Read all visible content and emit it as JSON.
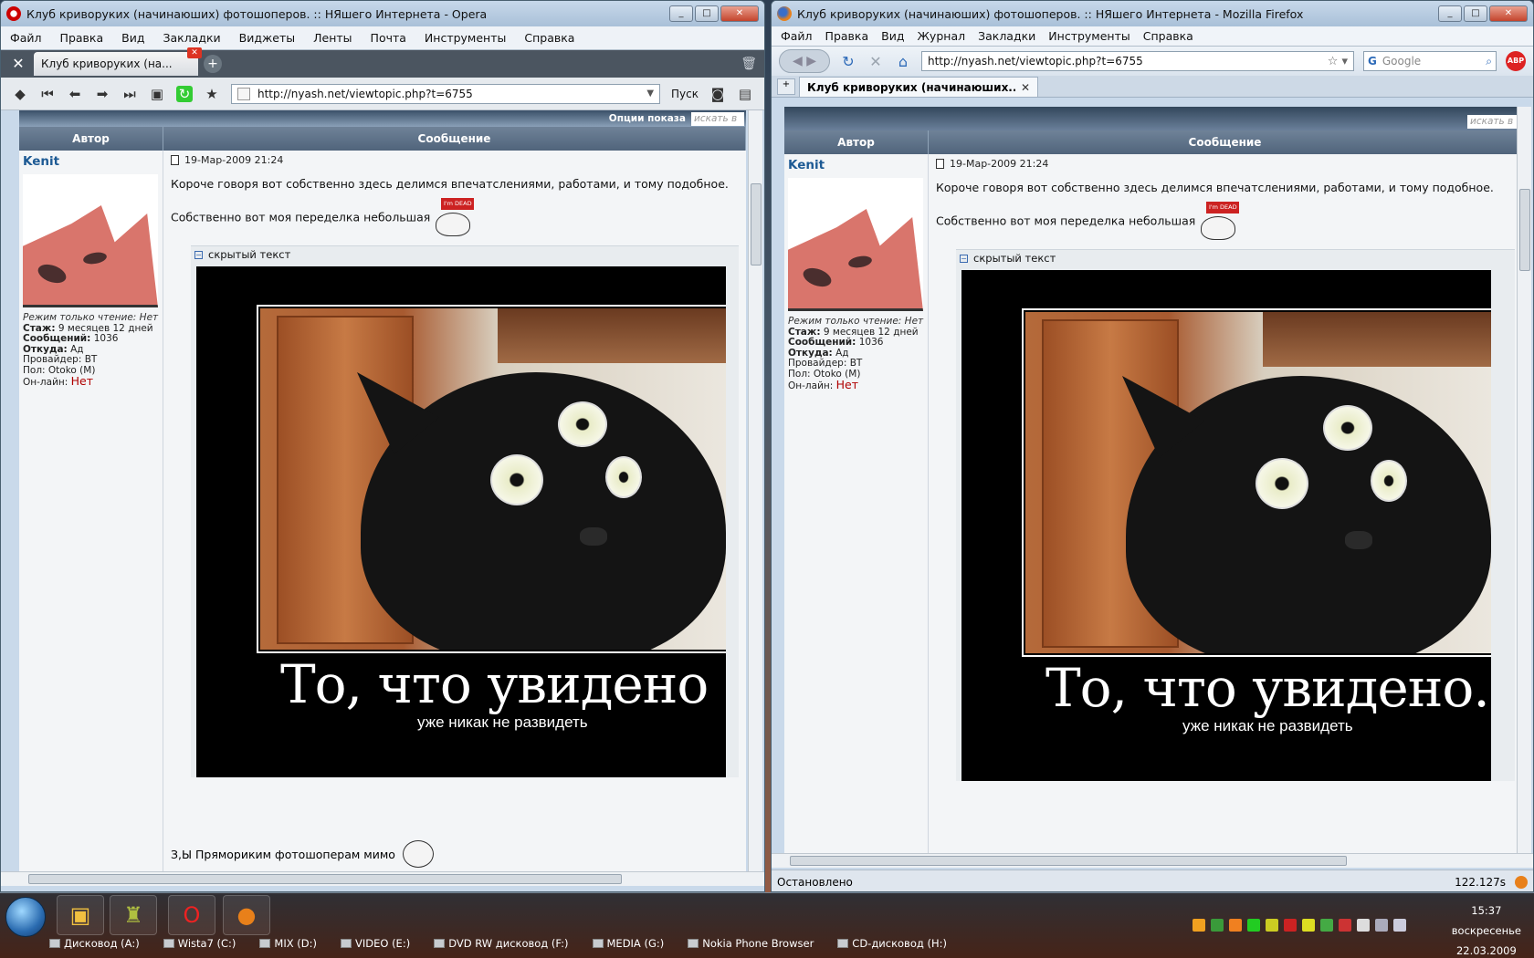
{
  "opera": {
    "title": "Клуб криворуких (начинаюших) фотошоперов. :: НЯшего Интернета - Opera",
    "menu": [
      "Файл",
      "Правка",
      "Вид",
      "Закладки",
      "Виджеты",
      "Ленты",
      "Почта",
      "Инструменты",
      "Справка"
    ],
    "tab_label": "Клуб криворуких (на...",
    "url": "http://nyash.net/viewtopic.php?t=6755",
    "go_label": "Пуск",
    "view_options": "Опции показа",
    "search_placeholder": "искать в"
  },
  "firefox": {
    "title": "Клуб криворуких (начинаюших) фотошоперов. :: НЯшего Интернета - Mozilla Firefox",
    "menu": [
      "Файл",
      "Правка",
      "Вид",
      "Журнал",
      "Закладки",
      "Инструменты",
      "Справка"
    ],
    "tab_label": "Клуб криворуких (начинаюших...",
    "url": "http://nyash.net/viewtopic.php?t=6755",
    "search_placeholder": "Google",
    "site_search_placeholder": "искать в",
    "status": "Остановлено",
    "timer": "122.127s"
  },
  "forum": {
    "col_author": "Автор",
    "col_message": "Сообщение",
    "author_name": "Kenit",
    "readonly": "Режим только чтение: Нет",
    "tenure_label": "Стаж:",
    "tenure": "9 месяцев 12 дней",
    "posts_label": "Сообщений:",
    "posts": "1036",
    "from_label": "Откуда:",
    "from": "Ад",
    "provider": "Провайдер: ВТ",
    "gender": "Пол: Otoko (M)",
    "online_label": "Он-лайн:",
    "online": "Нет",
    "date": "19-Мар-2009 21:24",
    "line1": "Короче говоря вот собственно здесь делимся впечатслениями, работами, и тому подобное.",
    "line2": "Собственно вот моя переделка небольшая",
    "im_dead": "I'm DEAD",
    "spoiler_title": "скрытый текст",
    "motiv_big": "То, что увидено",
    "motiv_big_ff": "То, что увидено.",
    "motiv_small": "уже никак не развидеть",
    "after": "З,Ы Прямориким фотошоперам мимо"
  },
  "taskbar": {
    "drives": [
      "Дисковод (A:)",
      "Wista7 (C:)",
      "MIX (D:)",
      "VIDEO (E:)",
      "DVD RW дисковод (F:)",
      "MEDIA (G:)",
      "Nokia Phone Browser",
      "CD-дисковод (H:)"
    ],
    "time": "15:37",
    "weekday": "воскресенье",
    "date": "22.03.2009"
  }
}
